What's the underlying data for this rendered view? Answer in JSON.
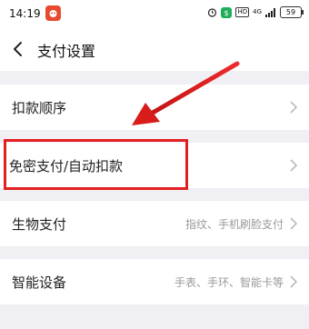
{
  "status_bar": {
    "time": "14:19",
    "battery": "59",
    "hd": "HD",
    "network": "4G",
    "icons": [
      "alarm-icon",
      "shield-app-icon",
      "hd-icon",
      "signal-icon",
      "battery-icon"
    ]
  },
  "header": {
    "title": "支付设置"
  },
  "rows": [
    {
      "label": "扣款顺序",
      "value": ""
    },
    {
      "label": "免密支付/自动扣款",
      "value": ""
    },
    {
      "label": "生物支付",
      "value": "指纹、手机刷脸支付"
    },
    {
      "label": "智能设备",
      "value": "手表、手环、智能卡等"
    }
  ],
  "colors": {
    "annotation_red": "#e32020",
    "background": "#efeff4",
    "muted_text": "#999999"
  }
}
